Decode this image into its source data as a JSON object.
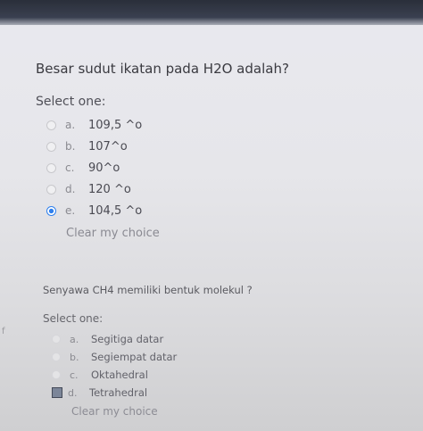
{
  "questions": [
    {
      "text": "Besar sudut ikatan pada H2O adalah?",
      "prompt": "Select one:",
      "options": [
        {
          "letter": "a.",
          "text": "109,5 ^o",
          "selected": false
        },
        {
          "letter": "b.",
          "text": "107^o",
          "selected": false
        },
        {
          "letter": "c.",
          "text": "90^o",
          "selected": false
        },
        {
          "letter": "d.",
          "text": "120 ^o",
          "selected": false
        },
        {
          "letter": "e.",
          "text": "104,5 ^o",
          "selected": true
        }
      ],
      "clear_label": "Clear my choice"
    },
    {
      "text": "Senyawa CH4 memiliki bentuk molekul ?",
      "prompt": "Select one:",
      "options": [
        {
          "letter": "a.",
          "text": "Segitiga datar",
          "selected": false
        },
        {
          "letter": "b.",
          "text": "Segiempat datar",
          "selected": false
        },
        {
          "letter": "c.",
          "text": "Oktahedral",
          "selected": false
        },
        {
          "letter": "d.",
          "text": "Tetrahedral",
          "selected": true
        }
      ],
      "clear_label": "Clear my choice"
    }
  ],
  "colors": {
    "accent": "#2f80ed",
    "background": "#e6e6ea"
  }
}
